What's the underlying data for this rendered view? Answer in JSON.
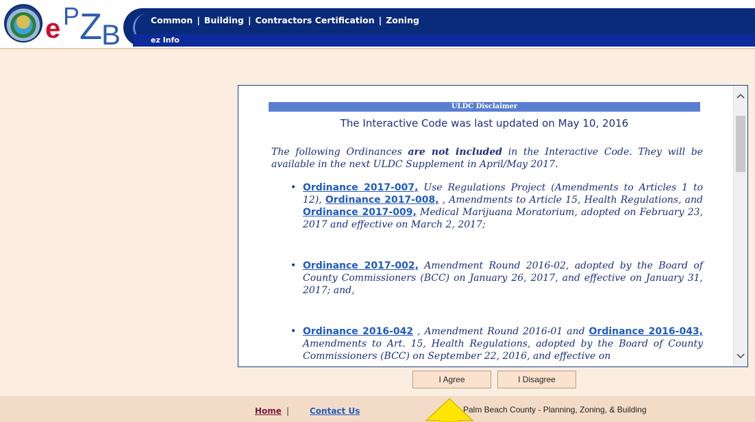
{
  "header": {
    "logo_text": "ePZB",
    "nav": [
      "Common",
      "Building",
      "Contractors Certification",
      "Zoning"
    ],
    "subnav": "ez Info"
  },
  "disclaimer": {
    "title": "ULDC Disclaimer",
    "updated": "The Interactive Code was last updated on May 10, 2016",
    "intro_pre": "The following Ordinances ",
    "intro_bold": "are not included",
    "intro_post": " in the Interactive Code. They will be available in the next ULDC Supplement in April/May 2017.",
    "items": [
      {
        "l1": "Ordinance 2017-007,",
        "t1": " Use Regulations Project (Amendments to Articles 1 to 12), ",
        "l2": "Ordinance 2017-008,",
        "t2": " , Amendments to Article 15, Health Regulations, and ",
        "l3": "Ordinance 2017-009,",
        "t3": " Medical Marijuana Moratorium, adopted on February 23, 2017 and effective on March 2, 2017;"
      },
      {
        "l1": "Ordinance 2017-002,",
        "t1": " Amendment Round 2016-02, adopted by the Board of County Commissioners (BCC) on January 26, 2017, and effective on January 31, 2017; and,"
      },
      {
        "l1": "Ordinance 2016-042",
        "t1": " , Amendment Round 2016-01 and ",
        "l2": "Ordinance 2016-043,",
        "t2": " Amendments to Art. 15, Health Regulations, adopted by the Board of County Commissioners (BCC) on September 22, 2016, and effective on"
      }
    ]
  },
  "scrollbar": {
    "up": "^",
    "down": "v"
  },
  "buttons": {
    "agree": "I Agree",
    "disagree": "I Disagree"
  },
  "footer": {
    "home": "Home",
    "separator": "|",
    "contact": "Contact Us",
    "copyright": "Palm Beach County - Planning, Zoning, & Building"
  },
  "colors": {
    "nav_bg": "#0a2a7a",
    "page_bg": "#fbeee1",
    "link": "#1f5bc4",
    "text": "#1a2f80",
    "arrow": "#ffe600"
  }
}
